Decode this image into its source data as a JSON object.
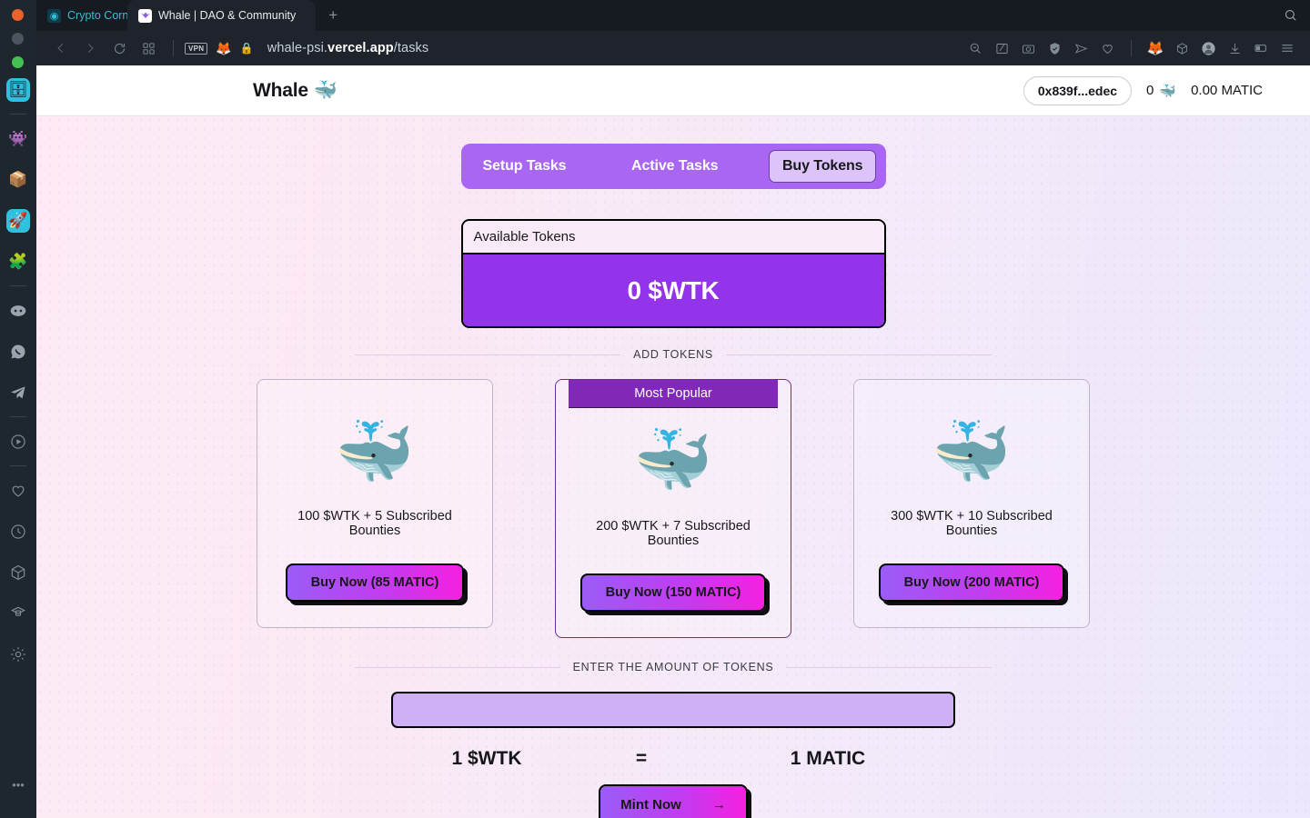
{
  "browser": {
    "tabs": [
      {
        "title": "Crypto Corn",
        "favicon": "crypto-corner-icon",
        "active": false
      },
      {
        "title": "Whale | DAO & Community",
        "favicon": "whale-favicon",
        "active": true
      }
    ],
    "new_tab_label": "+",
    "window_search_icon": "search-icon",
    "nav": {
      "back_icon": "chevron-left-icon",
      "forward_icon": "chevron-right-icon",
      "reload_icon": "reload-icon",
      "grid_icon": "tab-grid-icon"
    },
    "url_badges": {
      "vpn": "VPN",
      "wallet_icon": "metamask-fox-icon",
      "lock_icon": "lock-icon"
    },
    "url_prefix": "whale-psi.",
    "url_domain": "vercel.app",
    "url_suffix": "/tasks",
    "toolbar_icons": [
      "zoom-out-icon",
      "edit-pen-icon",
      "screenshot-camera-icon",
      "shield-check-icon",
      "send-icon",
      "heart-icon",
      "metamask-extension-icon",
      "cube-extension-icon",
      "account-avatar-icon",
      "download-icon",
      "reader-mode-icon",
      "menu-icon"
    ]
  },
  "dock": {
    "items": [
      {
        "icon": "wallet-app-icon",
        "glyph": "🗂",
        "tile": true
      },
      {
        "icon": "alien-app-icon",
        "glyph": "👾",
        "tile": false
      },
      {
        "icon": "package-app-icon",
        "glyph": "📦",
        "tile": false
      },
      {
        "icon": "rocket-app-icon",
        "glyph": "🚀",
        "tile": true
      },
      {
        "icon": "puzzle-app-icon",
        "glyph": "🧩",
        "tile": false
      },
      {
        "icon": "discord-app-icon",
        "glyph": "◉",
        "tile": false
      },
      {
        "icon": "whatsapp-app-icon",
        "glyph": "☎",
        "tile": false
      },
      {
        "icon": "telegram-app-icon",
        "glyph": "➤",
        "tile": false
      },
      {
        "icon": "media-play-icon",
        "glyph": "▷",
        "tile": false
      },
      {
        "icon": "heart-icon",
        "glyph": "♡",
        "tile": false
      },
      {
        "icon": "clock-icon",
        "glyph": "◴",
        "tile": false
      },
      {
        "icon": "cube-icon",
        "glyph": "⬡",
        "tile": false
      },
      {
        "icon": "badge-icon",
        "glyph": "⬢",
        "tile": false
      },
      {
        "icon": "settings-gear-icon",
        "glyph": "⚙",
        "tile": false
      }
    ],
    "more_label": "•••"
  },
  "site": {
    "brand": "Whale",
    "brand_emoji": "🐳",
    "wallet_address": "0x839f...edec",
    "whale_balance": "0",
    "whale_balance_emoji": "🐳",
    "matic_balance": "0.00 MATIC"
  },
  "tabs_nav": {
    "items": [
      {
        "label": "Setup Tasks",
        "selected": false
      },
      {
        "label": "Active Tasks",
        "selected": false
      },
      {
        "label": "Buy Tokens",
        "selected": true
      }
    ]
  },
  "available": {
    "label": "Available Tokens",
    "value": "0 $WTK"
  },
  "sections": {
    "add_tokens": "ADD TOKENS",
    "enter_amount": "ENTER THE AMOUNT OF TOKENS"
  },
  "plans": [
    {
      "banner": "",
      "emoji": "🐳",
      "description": "100 $WTK + 5 Subscribed Bounties",
      "button": "Buy Now (85 MATIC)"
    },
    {
      "banner": "Most Popular",
      "emoji": "🐳",
      "description": "200 $WTK + 7 Subscribed Bounties",
      "button": "Buy Now (150 MATIC)"
    },
    {
      "banner": "",
      "emoji": "🐳",
      "description": "300 $WTK + 10 Subscribed Bounties",
      "button": "Buy Now (200 MATIC)"
    }
  ],
  "mint": {
    "input_value": "",
    "input_placeholder": "",
    "rate_left": "1 $WTK",
    "rate_equals": "=",
    "rate_right": "1 MATIC",
    "button": "Mint Now",
    "button_arrow": "→"
  },
  "colors": {
    "accent_purple": "#a966f2",
    "deep_purple": "#9333ea",
    "banner_purple": "#8128b8",
    "magenta": "#f520e0",
    "input_lavender": "#cfb0f7"
  }
}
